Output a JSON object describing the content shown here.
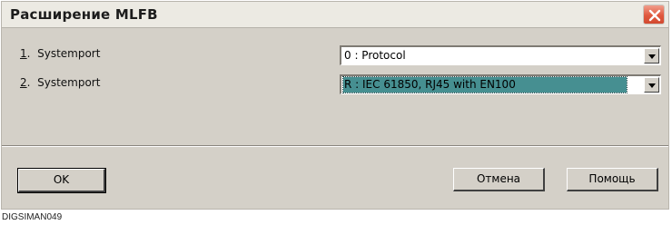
{
  "dialog": {
    "title": "Расширение MLFB",
    "close_icon": "close-icon"
  },
  "rows": [
    {
      "number": "1",
      "label": "Systemport",
      "selected": "0 : Protocol",
      "highlighted": false
    },
    {
      "number": "2",
      "label": "Systemport",
      "selected": "R : IEC 61850, RJ45 with EN100",
      "highlighted": true
    }
  ],
  "buttons": {
    "ok": "OK",
    "cancel": "Отмена",
    "help": "Помощь"
  },
  "caption": "DIGSIMAN049",
  "colors": {
    "close_button": "#e0593e",
    "highlight": "#468f91",
    "dialog_bg": "#d4d0c8"
  }
}
